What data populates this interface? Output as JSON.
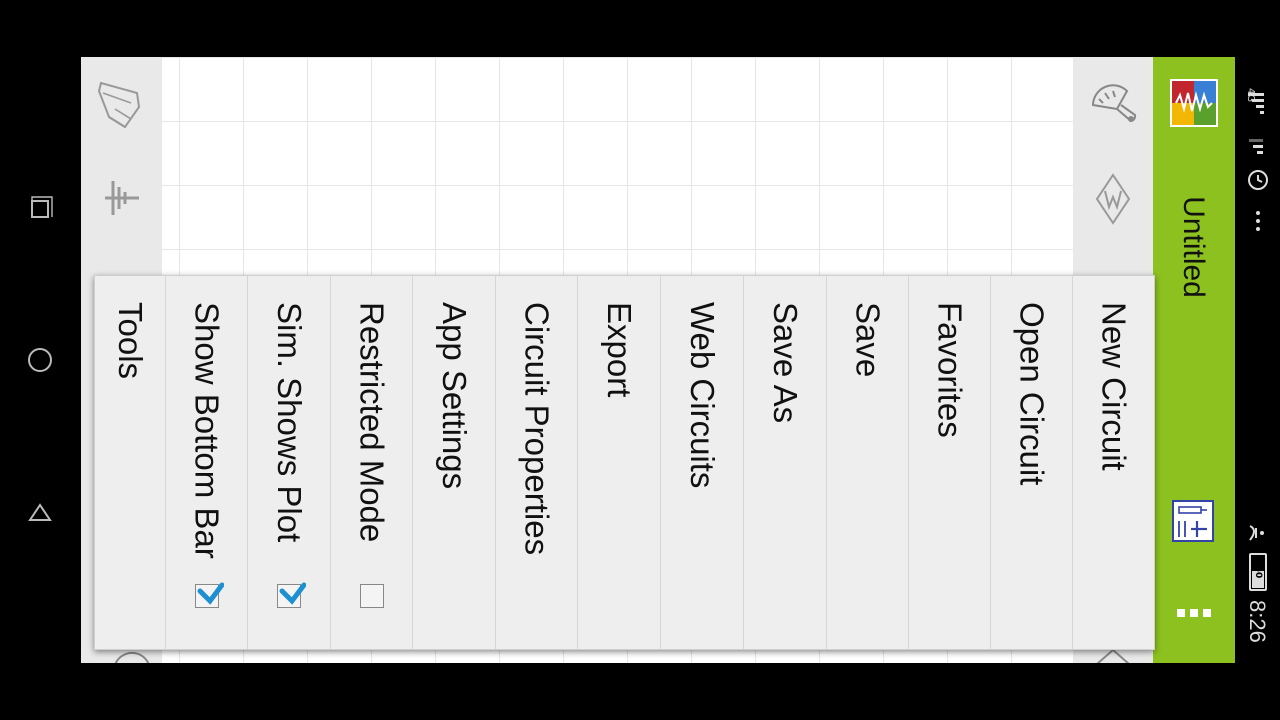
{
  "status_bar": {
    "network": "4G",
    "battery": "50",
    "time": "8:26"
  },
  "app": {
    "title": "Untitled"
  },
  "menu": {
    "items": [
      {
        "label": "New Circuit"
      },
      {
        "label": "Open Circuit"
      },
      {
        "label": "Favorites"
      },
      {
        "label": "Save"
      },
      {
        "label": "Save As"
      },
      {
        "label": "Web Circuits"
      },
      {
        "label": "Export"
      },
      {
        "label": "Circuit Properties"
      },
      {
        "label": "App Settings"
      },
      {
        "label": "Restricted Mode",
        "checked": false
      },
      {
        "label": "Sim. Shows Plot",
        "checked": true
      },
      {
        "label": "Show Bottom Bar",
        "checked": true
      },
      {
        "label": "Tools"
      }
    ]
  },
  "colors": {
    "accent_green": "#8cc11f",
    "toolbar_gray": "#e9e9e9",
    "check_blue": "#1e8fd0"
  },
  "icons": {
    "nav": [
      "recent-apps-icon",
      "home-icon",
      "back-icon"
    ],
    "left_toolbar": [
      "pencil-icon",
      "ground-icon"
    ],
    "right_toolbar": [
      "tools-icon",
      "wire-mode-icon"
    ],
    "title_bar": [
      "app-logo-icon",
      "add-component-icon",
      "more-icon"
    ]
  }
}
